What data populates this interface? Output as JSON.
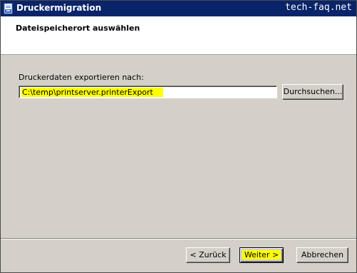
{
  "window": {
    "title": "Druckermigration",
    "watermark": "tech-faq.net"
  },
  "header": {
    "title": "Dateispeicherort auswählen"
  },
  "export": {
    "label": "Druckerdaten exportieren nach:",
    "path_value": "C:\\temp\\printserver.printerExport",
    "browse_label": "Durchsuchen..."
  },
  "footer": {
    "back_label": "< Zurück",
    "next_label": "Weiter >",
    "cancel_label": "Abbrechen"
  },
  "colors": {
    "titlebar": "#0a246a",
    "dialog": "#d4d0c8",
    "highlight": "#ffff00"
  },
  "icons": {
    "title": "printer-migration-icon"
  }
}
